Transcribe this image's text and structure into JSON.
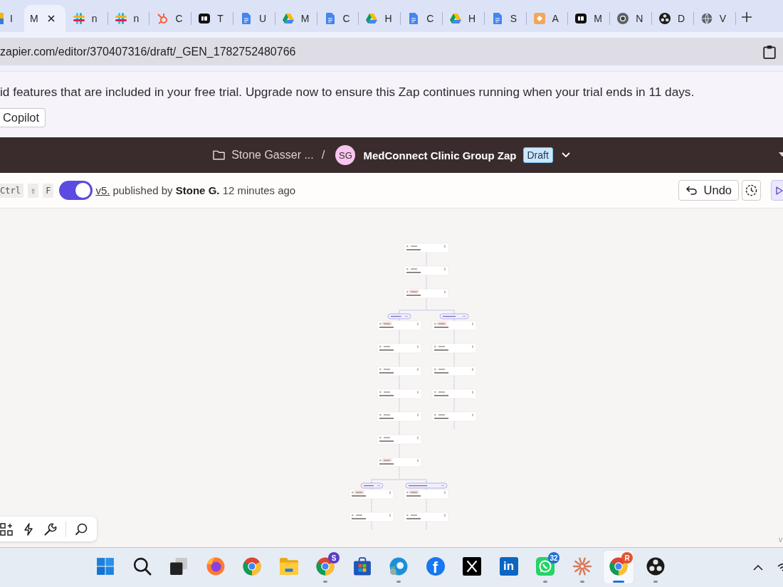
{
  "browser": {
    "tabs": [
      {
        "title": "I",
        "kind": "multicolor",
        "selected": false
      },
      {
        "title": "M",
        "kind": "none",
        "selected": true
      },
      {
        "title": "n",
        "kind": "hash",
        "selected": false
      },
      {
        "title": "n",
        "kind": "hash",
        "selected": false
      },
      {
        "title": "C",
        "kind": "sprocket",
        "selected": false
      },
      {
        "title": "T",
        "kind": "tile",
        "selected": false
      },
      {
        "title": "U",
        "kind": "doc",
        "selected": false
      },
      {
        "title": "M",
        "kind": "triangle",
        "selected": false
      },
      {
        "title": "C",
        "kind": "doc",
        "selected": false
      },
      {
        "title": "H",
        "kind": "triangle",
        "selected": false
      },
      {
        "title": "C",
        "kind": "doc",
        "selected": false
      },
      {
        "title": "H",
        "kind": "triangle",
        "selected": false
      },
      {
        "title": "S",
        "kind": "doc",
        "selected": false
      },
      {
        "title": "A",
        "kind": "arrow",
        "selected": false
      },
      {
        "title": "M",
        "kind": "tile",
        "selected": false
      },
      {
        "title": "N",
        "kind": "ring",
        "selected": false
      },
      {
        "title": "D",
        "kind": "aperture",
        "selected": false
      },
      {
        "title": "V",
        "kind": "globe",
        "selected": false
      }
    ],
    "address": "zapier.com/editor/370407316/draft/_GEN_1782752480766"
  },
  "banner": {
    "message": "id features that are included in your free trial. Upgrade now to ensure this Zap continues running when your trial ends in 11 days.",
    "button": "Copilot"
  },
  "header": {
    "folder": "Stone Gasser ...",
    "separator": "/",
    "avatar": "SG",
    "zap_name": "MedConnect Clinic Group Zap",
    "status": "Draft"
  },
  "toolbar": {
    "shortcut_keys": [
      "Ctrl",
      "⇧",
      "F"
    ],
    "toggle": {
      "on": true
    },
    "version": "v5.",
    "published": "published by **Stone G.** 12 minutes ago",
    "undo": "Undo"
  },
  "canvas": {
    "corner_text": "v"
  },
  "taskbar": {
    "items": [
      {
        "kind": "windows",
        "running": false,
        "active": false
      },
      {
        "kind": "search",
        "running": false,
        "active": false
      },
      {
        "kind": "taskview",
        "running": false,
        "active": false
      },
      {
        "kind": "firefox",
        "running": false,
        "active": false
      },
      {
        "kind": "chrome",
        "running": false,
        "active": false
      },
      {
        "kind": "folder",
        "running": false,
        "active": false
      },
      {
        "kind": "chrome",
        "badge": {
          "text": "S",
          "color": "#5b3fc2"
        },
        "running": true,
        "active": false
      },
      {
        "kind": "store",
        "running": false,
        "active": false
      },
      {
        "kind": "edge",
        "running": true,
        "active": false
      },
      {
        "kind": "facebook",
        "label": "f",
        "running": false,
        "active": false
      },
      {
        "kind": "x",
        "running": false,
        "active": false
      },
      {
        "kind": "linkedin",
        "label": "in",
        "running": false,
        "active": false
      },
      {
        "kind": "whatsapp",
        "badge": {
          "text": "32",
          "color": "#1d6fd4"
        },
        "running": true,
        "active": false
      },
      {
        "kind": "starburst",
        "running": true,
        "active": false
      },
      {
        "kind": "chrome",
        "badge": {
          "text": "R",
          "color": "#e4532f"
        },
        "running": true,
        "active": true
      },
      {
        "kind": "obs",
        "running": true,
        "active": false
      }
    ]
  }
}
